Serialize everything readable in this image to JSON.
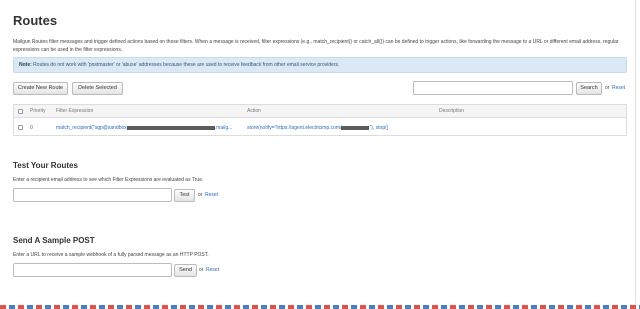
{
  "routes": {
    "title": "Routes",
    "intro": "Mailgun Routes filter messages and trigger defined actions based on those filters. When a message is received, filter expressions (e.g., match_recipient() or catch_all()) can be defined to trigger actions, like forwarding the message to a URL or different email address, regular expressions can be used in the filter expressions.",
    "note_label": "Note:",
    "note_text": "Routes do not work with 'postmaster' or 'abuse' addresses because these are used to receive feedback from other email service providers.",
    "create_button": "Create New Route",
    "delete_button": "Delete Selected",
    "search_button": "Search",
    "search_value": "",
    "or_text": "or",
    "reset_link": "Reset"
  },
  "table": {
    "headers": {
      "priority": "Priority",
      "filter": "Filter Expression",
      "action": "Action",
      "description": "Description"
    },
    "rows": [
      {
        "priority": "0",
        "filter_prefix": "match_recipient(\"sgp@sandbox",
        "filter_suffix": ".mailg...",
        "action_prefix": "store(notify=\"https://agent.electricimp.com/",
        "action_suffix": "\"), stop()",
        "description": ""
      }
    ]
  },
  "test_routes": {
    "heading": "Test Your Routes",
    "desc": "Enter a recipient email address to see which Filter Expressions are evaluated as True.",
    "input_value": "",
    "button": "Test",
    "or_text": "or",
    "reset_link": "Reset"
  },
  "sample_post": {
    "heading": "Send A Sample POST",
    "desc": "Enter a URL to receive a sample webhook of a fully parsed message as an HTTP POST.",
    "input_value": "",
    "button": "Send",
    "or_text": "or",
    "reset_link": "Reset"
  },
  "colors": {
    "link": "#2a6ebb",
    "note_bg": "#dbe8f5",
    "stripe_red": "#d9534f",
    "stripe_blue": "#4a7fc1"
  }
}
